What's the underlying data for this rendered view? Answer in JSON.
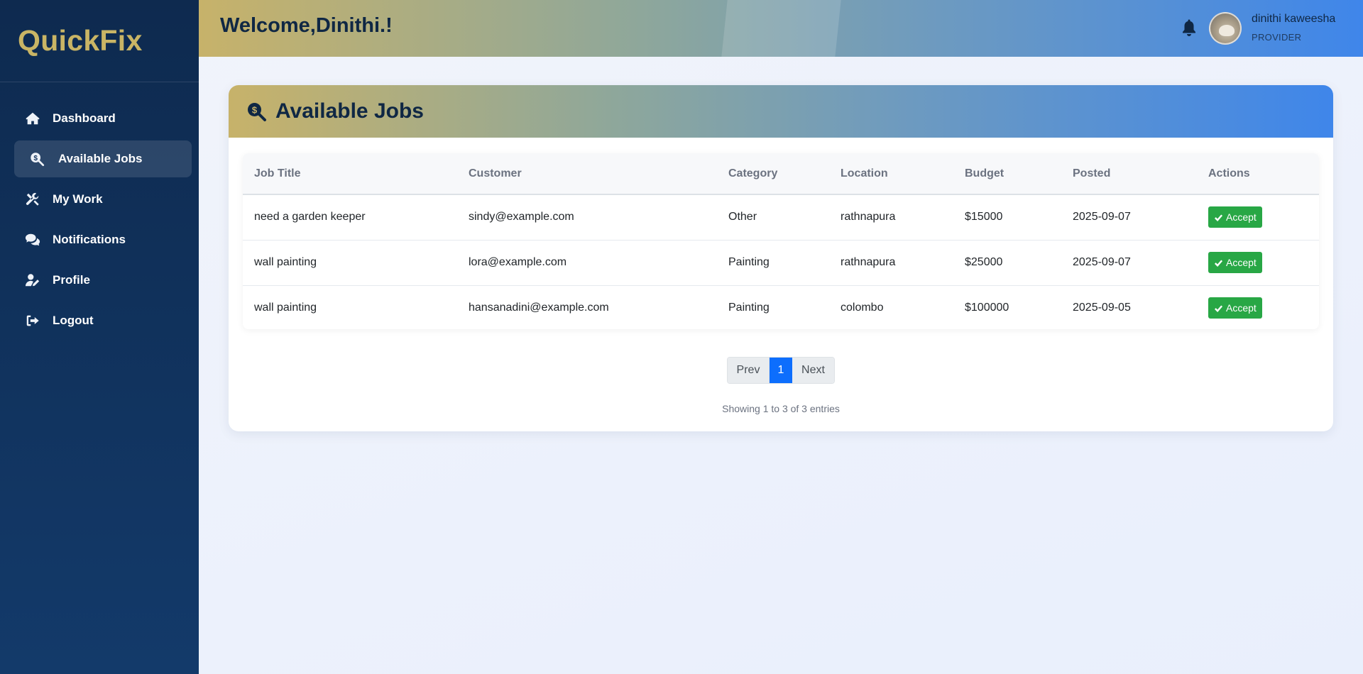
{
  "app": {
    "brand": "QuickFix"
  },
  "sidebar": {
    "items": [
      {
        "label": "Dashboard",
        "icon": "home-icon"
      },
      {
        "label": "Available Jobs",
        "icon": "search-dollar-icon",
        "active": true
      },
      {
        "label": "My Work",
        "icon": "tools-icon"
      },
      {
        "label": "Notifications",
        "icon": "comments-icon"
      },
      {
        "label": "Profile",
        "icon": "user-edit-icon"
      },
      {
        "label": "Logout",
        "icon": "sign-out-icon"
      }
    ]
  },
  "header": {
    "welcome": "Welcome,Dinithi.!",
    "user_name": "dinithi kaweesha",
    "user_role": "PROVIDER"
  },
  "jobs": {
    "title": "Available Jobs",
    "columns": [
      "Job Title",
      "Customer",
      "Category",
      "Location",
      "Budget",
      "Posted",
      "Actions"
    ],
    "rows": [
      [
        "need a garden keeper",
        "sindy@example.com",
        "Other",
        "rathnapura",
        "$15000",
        "2025-09-07"
      ],
      [
        "wall painting",
        "lora@example.com",
        "Painting",
        "rathnapura",
        "$25000",
        "2025-09-07"
      ],
      [
        "wall painting",
        "hansanadini@example.com",
        "Painting",
        "colombo",
        "$100000",
        "2025-09-05"
      ]
    ],
    "accept_label": "Accept"
  },
  "pagination": {
    "prev": "Prev",
    "current": "1",
    "next": "Next",
    "summary": "Showing 1 to 3 of 3 entries"
  },
  "colors": {
    "brand": "#c9b565",
    "sidebar": "#0e2a4f",
    "accept": "#28a745",
    "page_active": "#0d6efd"
  }
}
